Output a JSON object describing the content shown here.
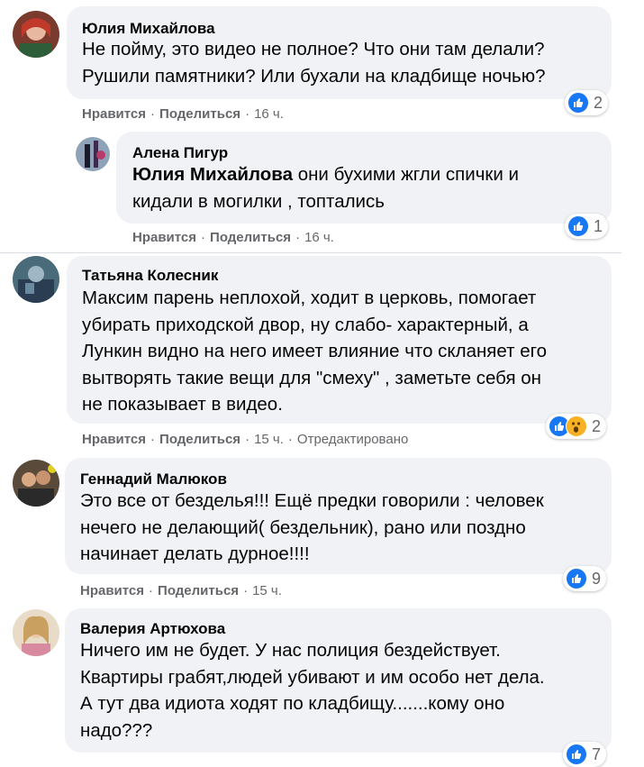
{
  "actions": {
    "like": "Нравится",
    "share": "Поделиться",
    "sep": "·"
  },
  "comments": [
    {
      "author": "Юлия Михайлова",
      "lines": [
        "Не пойму, это видео не полное? Что они там делали?",
        "Рушили памятники? Или бухали на кладбище ночью?"
      ],
      "time": "16 ч.",
      "reactions": "2",
      "reply": {
        "author": "Алена Пигур",
        "mention": "Юлия Михайлова",
        "lines": [
          " они бухими жгли спички и",
          "кидали в могилки , топтались"
        ],
        "time": "16 ч.",
        "reactions": "1"
      }
    },
    {
      "author": "Татьяна Колесник",
      "lines": [
        "Максим парень неплохой, ходит в церковь, помогает",
        "убирать приходской двор, ну слабо- характерный, а",
        "Лункин видно на него имеет влияние что скланяет его",
        "вытворять такие вещи для \"смеху\" , заметьте себя он",
        "не показывает в видео."
      ],
      "time": "15 ч.",
      "edited": "Отредактировано",
      "reactions": "2"
    },
    {
      "author": "Геннадий Малюков",
      "lines": [
        "Это все от безделья!!! Ещё предки говорили : человек",
        "нечего не делающий( бездельник), рано или поздно",
        "начинает делать дурное!!!!"
      ],
      "time": "15 ч.",
      "reactions": "9"
    },
    {
      "author": "Валерия Артюхова",
      "lines": [
        "Ничего им не будет. У нас полиция бездействует.",
        "Квартиры грабят,людей убивают и им особо нет дела.",
        "А тут два идиота ходят по кладбищу.......кому оно",
        "надо???"
      ],
      "reactions": "7"
    }
  ],
  "colors": {
    "bubble": "#f0f2f5",
    "like": "#1877f2",
    "meta": "#65676b"
  }
}
